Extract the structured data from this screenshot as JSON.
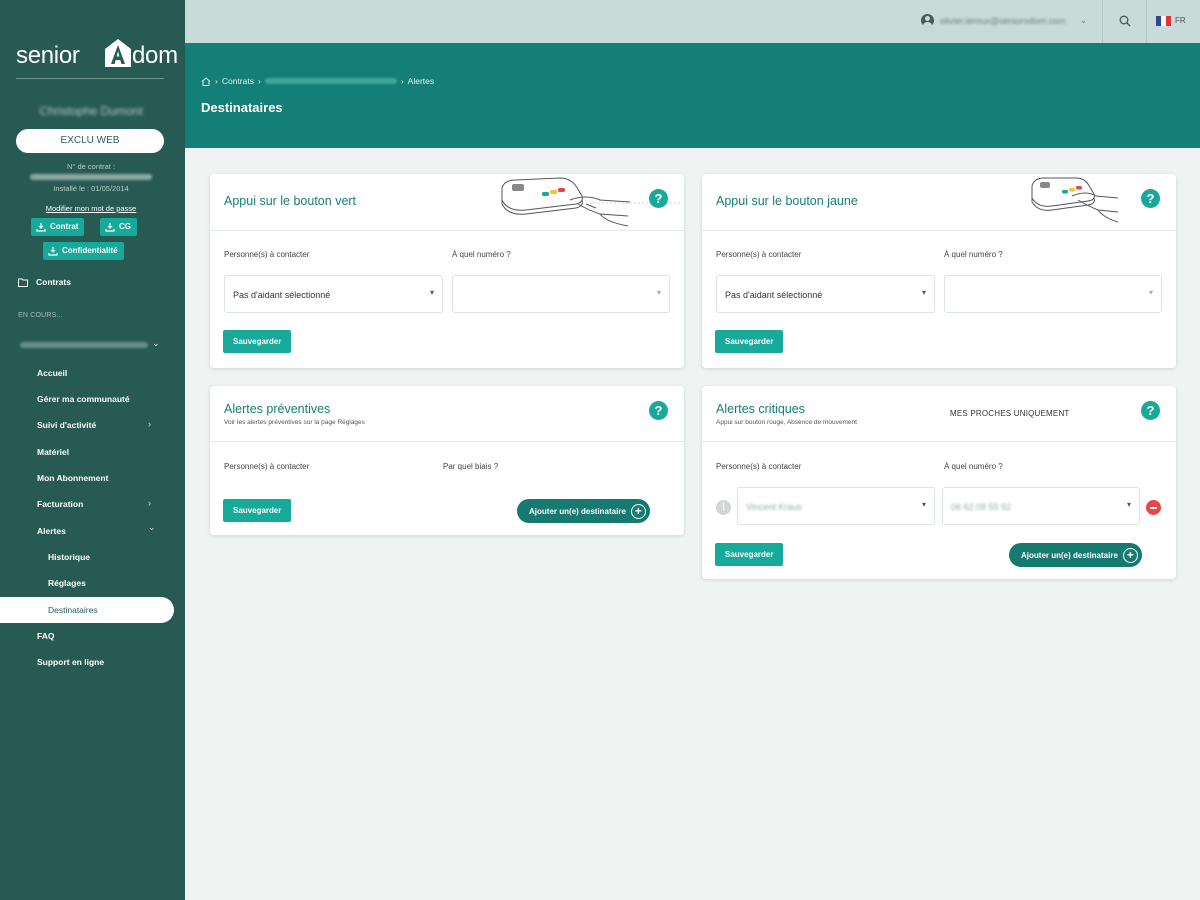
{
  "brand": {
    "name_part1": "senior",
    "name_part2": "dom"
  },
  "sidebar": {
    "user_name": "Christophe Dumont",
    "offer": "EXCLU WEB",
    "contract_label": "N° de contrat :",
    "since": "Installé le : 01/05/2014",
    "modify_link": "Modifier mon mot de passe",
    "downloads": [
      {
        "label": "Contrat",
        "icon": "download-icon"
      },
      {
        "label": "CG",
        "icon": "download-icon"
      },
      {
        "label": "Confidentialité",
        "icon": "download-icon"
      }
    ],
    "contrats": "Contrats",
    "en_cours": "EN COURS...",
    "nav": [
      {
        "label": "Accueil",
        "chevron": false
      },
      {
        "label": "Gérer ma communauté",
        "chevron": false
      },
      {
        "label": "Suivi d'activité",
        "chevron": true
      },
      {
        "label": "Matériel",
        "chevron": false
      },
      {
        "label": "Mon Abonnement",
        "chevron": false
      },
      {
        "label": "Facturation",
        "chevron": true
      },
      {
        "label": "Alertes",
        "chevron": true,
        "expanded": true
      }
    ],
    "sub_nav": [
      "Historique",
      "Réglages"
    ],
    "active": "Destinataires",
    "bottom_nav": [
      "FAQ",
      "Support en ligne"
    ]
  },
  "topbar": {
    "email": "olivier.leroux@seniorodom.com",
    "language": "FR"
  },
  "header": {
    "breadcrumb": [
      "Contrats",
      "Alertes"
    ],
    "title": "Destinataires"
  },
  "cards": {
    "green": {
      "title": "Appui sur le bouton vert",
      "persons_label": "Personne(s) à contacter",
      "number_label": "À quel numéro ?",
      "person_value": "Pas d'aidant sélectionné",
      "save": "Sauvegarder"
    },
    "yellow": {
      "title": "Appui sur le bouton jaune",
      "persons_label": "Personne(s) à contacter",
      "number_label": "À quel numéro ?",
      "person_value": "Pas d'aidant sélectionné",
      "save": "Sauvegarder"
    },
    "preventive": {
      "title": "Alertes préventives",
      "subtitle": "Voir les alertes préventives sur la page Réglages",
      "persons_label": "Personne(s) à contacter",
      "channel_label": "Par quel biais ?",
      "save": "Sauvegarder",
      "add": "Ajouter un(e) destinataire"
    },
    "critical": {
      "title": "Alertes critiques",
      "subtitle": "Appui sur bouton rouge, Absence de mouvement",
      "scope": "MES PROCHES UNIQUEMENT",
      "persons_label": "Personne(s) à contacter",
      "number_label": "À quel numéro ?",
      "person_value": "Vincent Kraus",
      "number_value": "06 62 08 55 92",
      "save": "Sauvegarder",
      "add": "Ajouter un(e) destinataire"
    }
  },
  "colors": {
    "sidebar": "#275a53",
    "header_band": "#137f77",
    "accent": "#17a99a",
    "danger": "#e8474a"
  }
}
